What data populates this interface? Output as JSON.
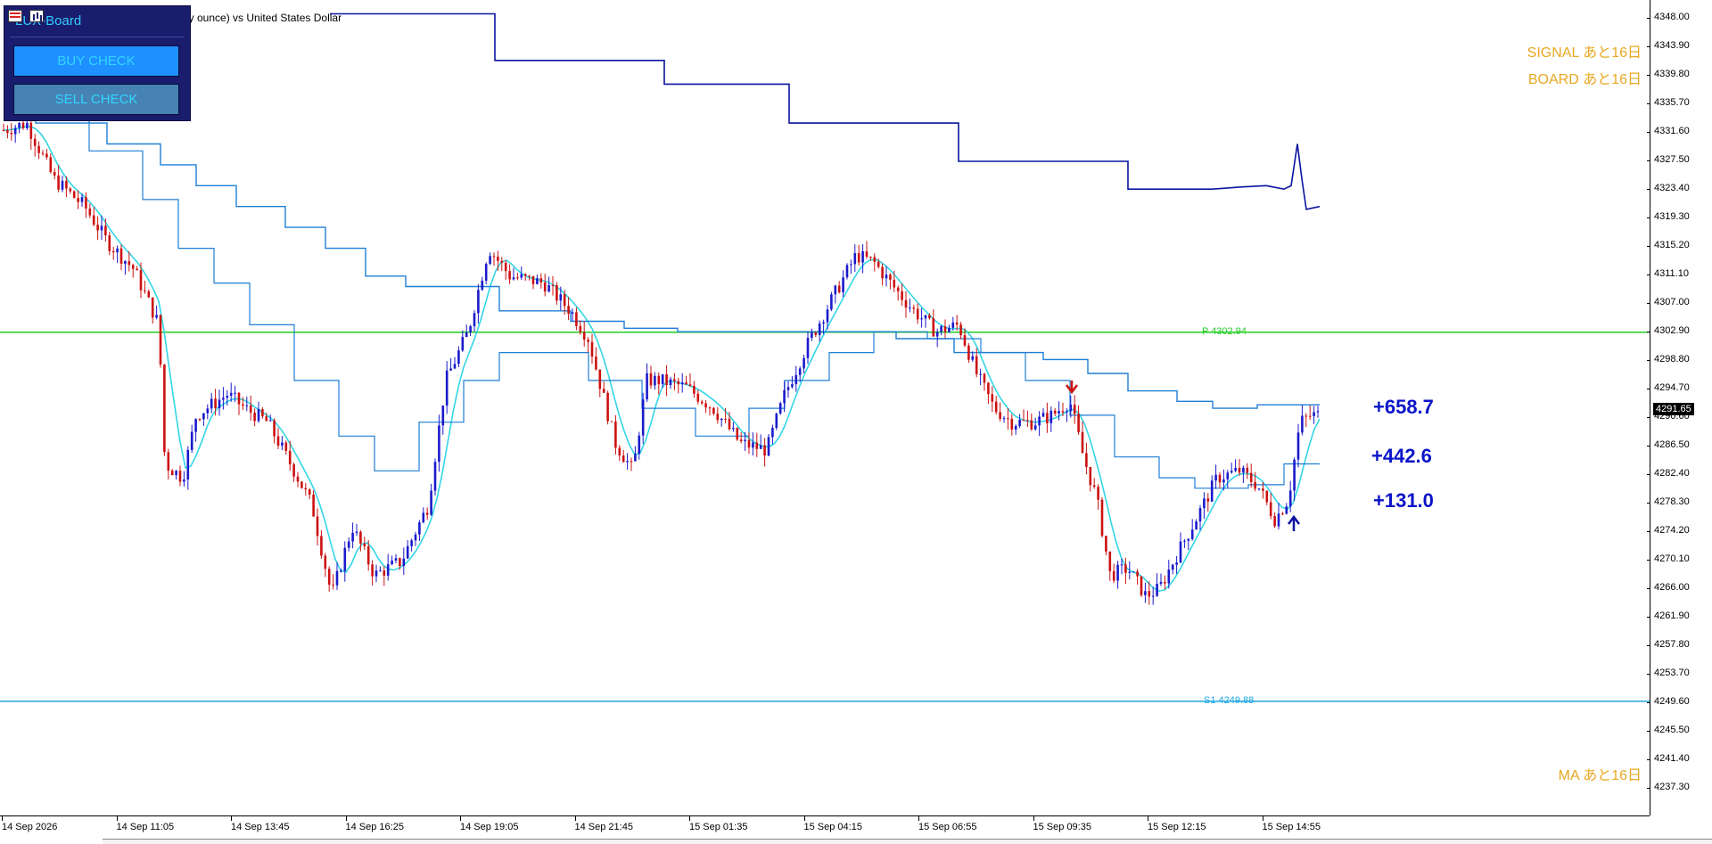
{
  "chart": {
    "symbol_title": "oy ounce) vs United States Dollar",
    "current_price": "4291.65",
    "price_ticks": [
      "4348.00",
      "4343.90",
      "4339.80",
      "4335.70",
      "4331.60",
      "4327.50",
      "4323.40",
      "4319.30",
      "4315.20",
      "4311.10",
      "4307.00",
      "4302.90",
      "4298.80",
      "4294.70",
      "4290.60",
      "4286.50",
      "4282.40",
      "4278.30",
      "4274.20",
      "4270.10",
      "4266.00",
      "4261.90",
      "4257.80",
      "4253.70",
      "4249.60",
      "4245.50",
      "4241.40",
      "4237.30"
    ],
    "time_ticks": [
      "14 Sep 2026",
      "14 Sep 11:05",
      "14 Sep 13:45",
      "14 Sep 16:25",
      "14 Sep 19:05",
      "14 Sep 21:45",
      "15 Sep 01:35",
      "15 Sep 04:15",
      "15 Sep 06:55",
      "15 Sep 09:35",
      "15 Sep 12:15",
      "15 Sep 14:55"
    ],
    "pivot_label": "P 4302.94",
    "s1_label": "S1 4249.88",
    "pivot_price": 4302.94,
    "s1_price": 4249.88,
    "colors": {
      "bull_candle": "#1a1acc",
      "bear_candle": "#cc1111",
      "ma_fast": "#33d6e6",
      "band": "#1e7fd6",
      "upper": "#0a14a0",
      "pivot": "#22cc22",
      "s1": "#1ca6e0",
      "label_orange": "#e8a820",
      "profit": "#0a14c8"
    }
  },
  "lux_board": {
    "title": "LUX-Board",
    "buy_label": "BUY CHECK",
    "sell_label": "SELL CHECK",
    "icons": [
      "flag-icon",
      "bar-chart-icon"
    ]
  },
  "status_labels": {
    "signal": "SIGNAL あと16日",
    "board": "BOARD あと16日",
    "ma": "MA あと16日"
  },
  "profits": {
    "p1": "+658.7",
    "p2": "+442.6",
    "p3": "+131.0"
  }
}
